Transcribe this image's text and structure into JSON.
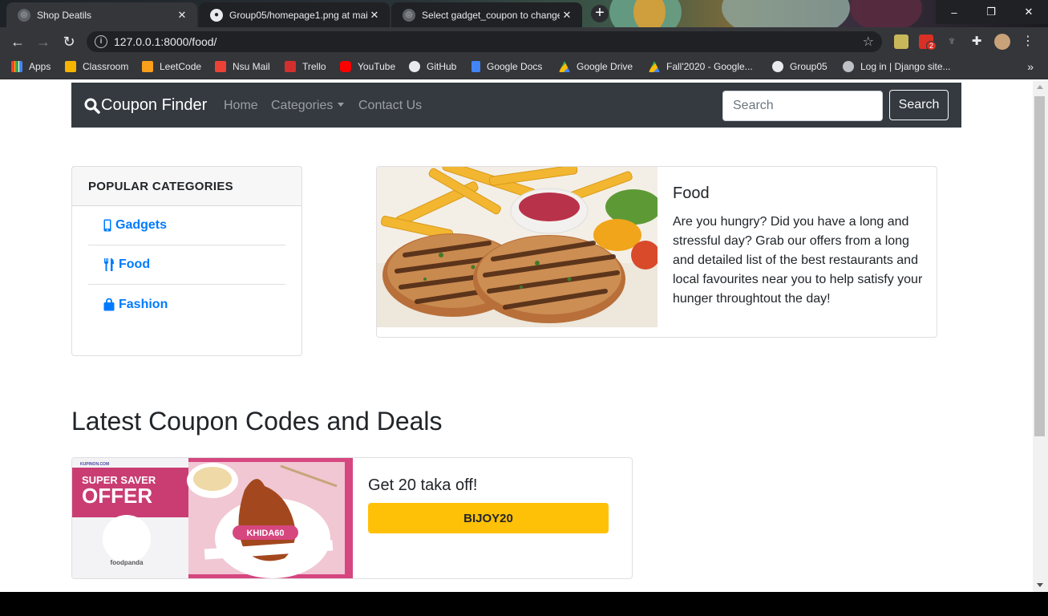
{
  "browser": {
    "tabs": [
      {
        "title": "Shop Deatils",
        "active": true
      },
      {
        "title": "Group05/homepage1.png at mai",
        "active": false
      },
      {
        "title": "Select gadget_coupon to change",
        "active": false
      }
    ],
    "new_tab": "+",
    "window_controls": {
      "minimize": "–",
      "restore": "❐",
      "close": "✕"
    },
    "url": "127.0.0.1:8000/food/",
    "notification_badge": "2",
    "bookmarks": [
      {
        "label": "Apps",
        "color": "#ea4335"
      },
      {
        "label": "Classroom",
        "color": "#f4b400"
      },
      {
        "label": "LeetCode",
        "color": "#f89f1b"
      },
      {
        "label": "Nsu Mail",
        "color": "#ea4335"
      },
      {
        "label": "Trello",
        "color": "#d32f2f"
      },
      {
        "label": "YouTube",
        "color": "#ff0000"
      },
      {
        "label": "GitHub",
        "color": "#e8eaed"
      },
      {
        "label": "Google Docs",
        "color": "#4285f4"
      },
      {
        "label": "Google Drive",
        "color": "#34a853"
      },
      {
        "label": "Fall'2020 - Google...",
        "color": "#fbbc04"
      },
      {
        "label": "Group05",
        "color": "#e8eaed"
      },
      {
        "label": "Log in | Django site...",
        "color": "#bdc1c6"
      }
    ],
    "bookmarks_more": "»"
  },
  "site": {
    "brand": "Coupon Finder",
    "nav": {
      "home": "Home",
      "categories": "Categories",
      "contact": "Contact Us"
    },
    "search": {
      "placeholder": "Search",
      "button": "Search"
    }
  },
  "sidebar": {
    "title": "POPULAR CATEGORIES",
    "items": [
      {
        "label": "Gadgets",
        "icon": "mobile-icon"
      },
      {
        "label": "Food",
        "icon": "utensils-icon"
      },
      {
        "label": "Fashion",
        "icon": "shopping-bag-icon"
      }
    ]
  },
  "hero": {
    "title": "Food",
    "description": "Are you hungry? Did you have a long and stressful day? Grab our offers from a long and detailed list of the best restaurants and local favourites near you to help satisfy your hunger throughtout the day!"
  },
  "deals": {
    "heading": "Latest Coupon Codes and Deals",
    "coupons": [
      {
        "title": "Get 20 taka off!",
        "code": "BIJOY20",
        "banner": {
          "top": "SUPER SAVER",
          "big": "OFFER",
          "brand": "foodpanda",
          "promo": "KHIDA60",
          "site": "KUPINON.COM"
        }
      }
    ]
  },
  "colors": {
    "navbar": "#343a40",
    "link": "#007bff",
    "coupon_button": "#ffc107",
    "banner_pink": "#d6467f"
  }
}
